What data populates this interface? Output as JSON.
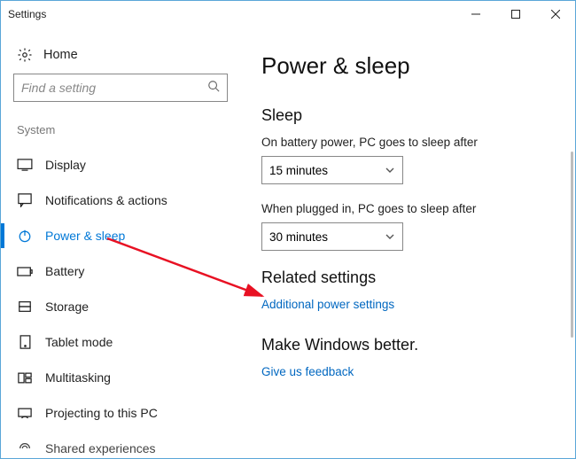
{
  "window": {
    "title": "Settings"
  },
  "sidebar": {
    "home_label": "Home",
    "search_placeholder": "Find a setting",
    "category": "System",
    "items": [
      {
        "label": "Display"
      },
      {
        "label": "Notifications & actions"
      },
      {
        "label": "Power & sleep"
      },
      {
        "label": "Battery"
      },
      {
        "label": "Storage"
      },
      {
        "label": "Tablet mode"
      },
      {
        "label": "Multitasking"
      },
      {
        "label": "Projecting to this PC"
      },
      {
        "label": "Shared experiences"
      }
    ]
  },
  "content": {
    "title": "Power & sleep",
    "sleep": {
      "heading": "Sleep",
      "battery_label": "On battery power, PC goes to sleep after",
      "battery_value": "15 minutes",
      "plugged_label": "When plugged in, PC goes to sleep after",
      "plugged_value": "30 minutes"
    },
    "related": {
      "heading": "Related settings",
      "link": "Additional power settings"
    },
    "feedback": {
      "heading": "Make Windows better.",
      "link": "Give us feedback"
    }
  }
}
